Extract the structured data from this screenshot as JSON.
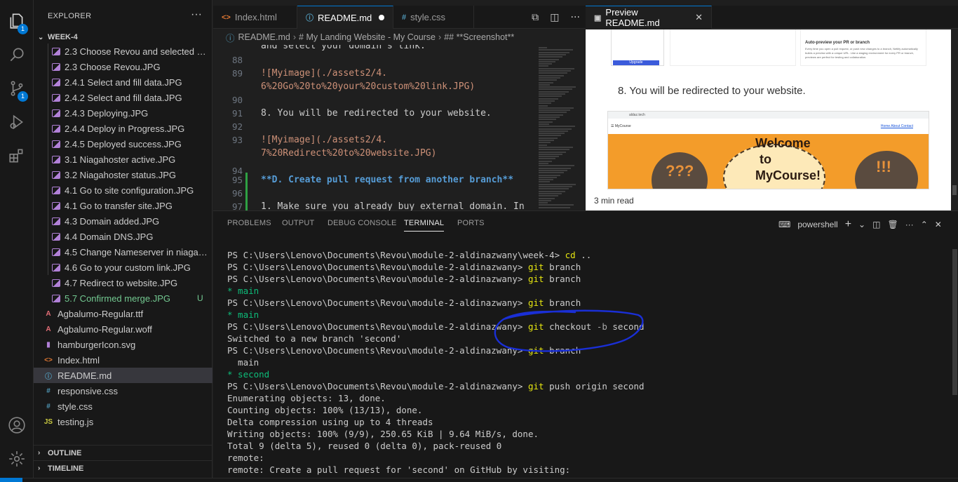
{
  "activity_bar": {
    "items": [
      {
        "name": "explorer",
        "badge": "1"
      },
      {
        "name": "search",
        "badge": ""
      },
      {
        "name": "source-control",
        "badge": "1"
      },
      {
        "name": "run-debug",
        "badge": ""
      },
      {
        "name": "extensions",
        "badge": ""
      }
    ]
  },
  "sidebar": {
    "title": "EXPLORER",
    "more": "···",
    "folder": "WEEK-4",
    "outline": "OUTLINE",
    "timeline": "TIMELINE",
    "files": [
      {
        "name": "2.3 Choose Revou and selected mo...",
        "type": "img",
        "status": ""
      },
      {
        "name": "2.3 Choose Revou.JPG",
        "type": "img",
        "status": ""
      },
      {
        "name": "2.4.1 Select and fill data.JPG",
        "type": "img",
        "status": ""
      },
      {
        "name": "2.4.2 Select and fill data.JPG",
        "type": "img",
        "status": ""
      },
      {
        "name": "2.4.3 Deploying.JPG",
        "type": "img",
        "status": ""
      },
      {
        "name": "2.4.4 Deploy in Progress.JPG",
        "type": "img",
        "status": ""
      },
      {
        "name": "2.4.5 Deployed success.JPG",
        "type": "img",
        "status": ""
      },
      {
        "name": "3.1 Niagahoster active.JPG",
        "type": "img",
        "status": ""
      },
      {
        "name": "3.2 Niagahoster status.JPG",
        "type": "img",
        "status": ""
      },
      {
        "name": "4.1 Go to site configuration.JPG",
        "type": "img",
        "status": ""
      },
      {
        "name": "4.1 Go to transfer site.JPG",
        "type": "img",
        "status": ""
      },
      {
        "name": "4.3 Domain added.JPG",
        "type": "img",
        "status": ""
      },
      {
        "name": "4.4 Domain DNS.JPG",
        "type": "img",
        "status": ""
      },
      {
        "name": "4.5 Change Nameserver in niagaho...",
        "type": "img",
        "status": ""
      },
      {
        "name": "4.6 Go to your custom link.JPG",
        "type": "img",
        "status": ""
      },
      {
        "name": "4.7 Redirect to website.JPG",
        "type": "img",
        "status": ""
      },
      {
        "name": "5.7 Confirmed merge.JPG",
        "type": "img",
        "status": "U"
      },
      {
        "name": "Agbalumo-Regular.ttf",
        "type": "font",
        "status": ""
      },
      {
        "name": "Agbalumo-Regular.woff",
        "type": "font",
        "status": ""
      },
      {
        "name": "hamburgerIcon.svg",
        "type": "svg",
        "status": ""
      },
      {
        "name": "Index.html",
        "type": "html",
        "status": ""
      },
      {
        "name": "README.md",
        "type": "md",
        "status": ""
      },
      {
        "name": "responsive.css",
        "type": "css",
        "status": ""
      },
      {
        "name": "style.css",
        "type": "css",
        "status": ""
      },
      {
        "name": "testing.js",
        "type": "js",
        "status": ""
      }
    ]
  },
  "tabs": [
    {
      "label": "Index.html",
      "icon": "<>",
      "active": false
    },
    {
      "label": "README.md",
      "icon": "ⓘ",
      "active": true
    },
    {
      "label": "style.css",
      "icon": "#",
      "active": false
    }
  ],
  "breadcrumb": [
    "README.md",
    "# My Landing Website - My Course",
    "## **Screenshot**"
  ],
  "editor": {
    "lines": [
      {
        "num": "",
        "text": "and select your domain's link."
      },
      {
        "num": "88",
        "text": ""
      },
      {
        "num": "89",
        "text": "![Myimage](./assets2/4."
      },
      {
        "num": "",
        "text": "6%20Go%20to%20your%20custom%20link.JPG)"
      },
      {
        "num": "90",
        "text": ""
      },
      {
        "num": "91",
        "text": "8. You will be redirected to your website."
      },
      {
        "num": "92",
        "text": ""
      },
      {
        "num": "93",
        "text": "![Myimage](./assets2/4."
      },
      {
        "num": "",
        "text": "7%20Redirect%20to%20website.JPG)"
      },
      {
        "num": "94",
        "text": ""
      },
      {
        "num": "95",
        "text": "**D. Create pull request from another branch**"
      },
      {
        "num": "96",
        "text": ""
      },
      {
        "num": "97",
        "text": "1. Make sure you already buy external domain. In"
      }
    ]
  },
  "preview": {
    "tab_label": "Preview README.md",
    "step_text": "8. You will be redirected to your website.",
    "card_heading": "Auto-preview your PR or branch",
    "card_text": "Every time you open a pull request, or push new changes to a branch, Netlify automatically builds a preview with a unique URL. Like a staging environment for every PR or branch, previews are perfect for testing and collaboration.",
    "upgrade_label": "Upgrade",
    "site_url": "aldaz.tech",
    "site_brand": "MyCourse",
    "site_nav": "Home About Contact",
    "welcome": [
      "Welcome",
      "to",
      "MyCourse!"
    ],
    "read_time": "3 min read"
  },
  "panel": {
    "tabs": [
      "PROBLEMS",
      "OUTPUT",
      "DEBUG CONSOLE",
      "TERMINAL",
      "PORTS"
    ],
    "active_tab": "TERMINAL",
    "shell_label": "powershell"
  },
  "terminal": {
    "prompt_week": "PS C:\\Users\\Lenovo\\Documents\\Revou\\module-2-aldinazwany\\week-4>",
    "prompt": "PS C:\\Users\\Lenovo\\Documents\\Revou\\module-2-aldinazwany>",
    "lines": [
      {
        "kind": "cmd-week",
        "cmd": "cd",
        "rest": " .."
      },
      {
        "kind": "cmd",
        "cmd": "git",
        "rest": " branch"
      },
      {
        "kind": "cmd",
        "cmd": "git",
        "rest": " branch"
      },
      {
        "kind": "green",
        "text": "* main"
      },
      {
        "kind": "cmd",
        "cmd": "git",
        "rest": " branch"
      },
      {
        "kind": "green",
        "text": "* main"
      },
      {
        "kind": "cmd-arg",
        "cmd": "git",
        "rest": " checkout ",
        "arg": "-b",
        "rest2": " second"
      },
      {
        "kind": "plain",
        "text": "Switched to a new branch 'second'"
      },
      {
        "kind": "cmd",
        "cmd": "git",
        "rest": " branch"
      },
      {
        "kind": "plain",
        "text": "  main"
      },
      {
        "kind": "green",
        "text": "* second"
      },
      {
        "kind": "cmd",
        "cmd": "git",
        "rest": " push origin second"
      },
      {
        "kind": "plain",
        "text": "Enumerating objects: 13, done."
      },
      {
        "kind": "plain",
        "text": "Counting objects: 100% (13/13), done."
      },
      {
        "kind": "plain",
        "text": "Delta compression using up to 4 threads"
      },
      {
        "kind": "plain",
        "text": "Writing objects: 100% (9/9), 250.65 KiB | 9.64 MiB/s, done."
      },
      {
        "kind": "plain",
        "text": "Total 9 (delta 5), reused 0 (delta 0), pack-reused 0"
      },
      {
        "kind": "plain",
        "text": "remote:"
      },
      {
        "kind": "plain",
        "text": "remote: Create a pull request for 'second' on GitHub by visiting:"
      }
    ]
  },
  "colors": {
    "accent": "#0078d4",
    "annotation_ink": "#1a2fd6",
    "untracked": "#73c991"
  }
}
